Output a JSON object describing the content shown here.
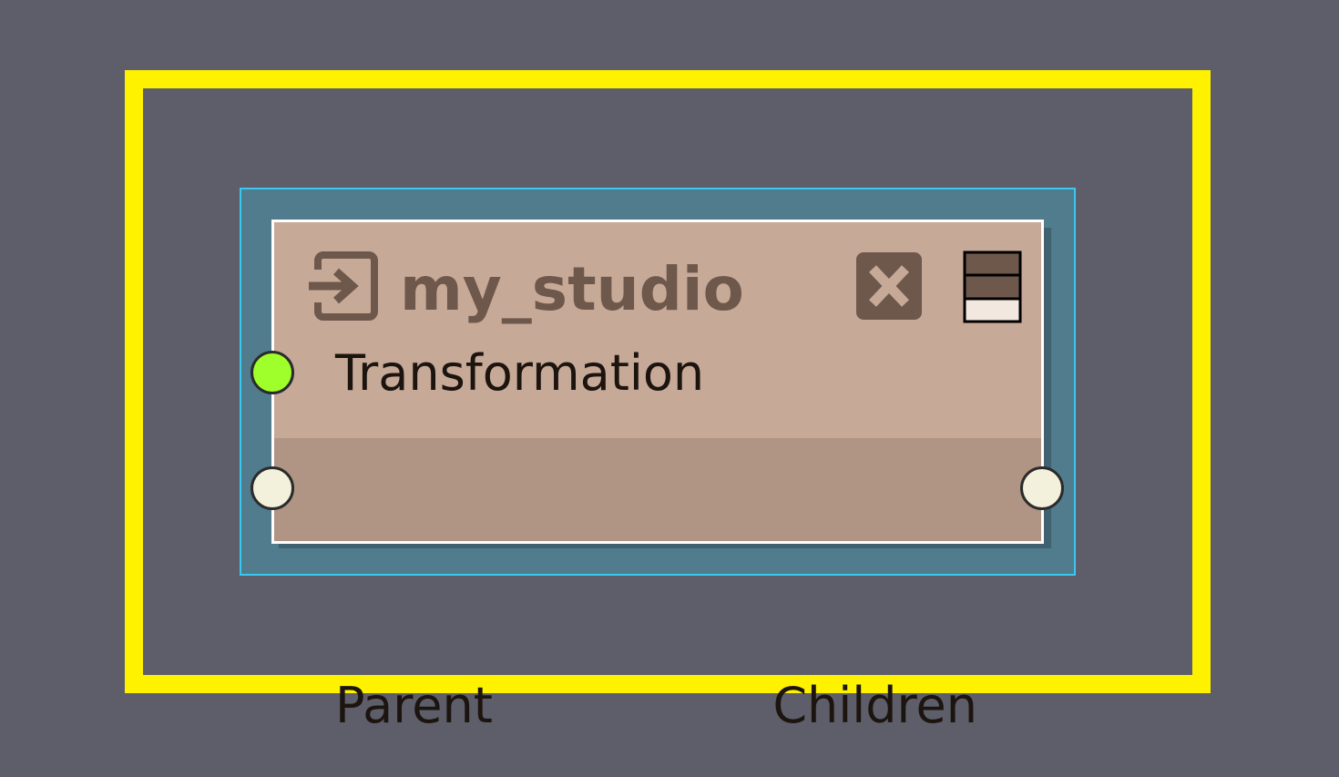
{
  "node": {
    "title": "my_studio",
    "icons": {
      "type_icon": "input-arrow-icon",
      "close_icon": "close-icon",
      "menu_icon": "layers-menu-icon"
    },
    "inputs": [
      {
        "label": "Transformation",
        "color": "#9eff2a"
      },
      {
        "label": "Parent",
        "color": "#f3f1dc"
      }
    ],
    "outputs": [
      {
        "label": "Children",
        "color": "#f3f1dc"
      }
    ]
  },
  "colors": {
    "background": "#5d5e69",
    "selection_frame": "#fff200",
    "node_highlight": "#507c8e",
    "node_highlight_border": "#39c8f0",
    "node_header": "#c7a998",
    "node_ports": "#b09484",
    "node_border": "#ffffff",
    "title_text": "#6e584b"
  }
}
